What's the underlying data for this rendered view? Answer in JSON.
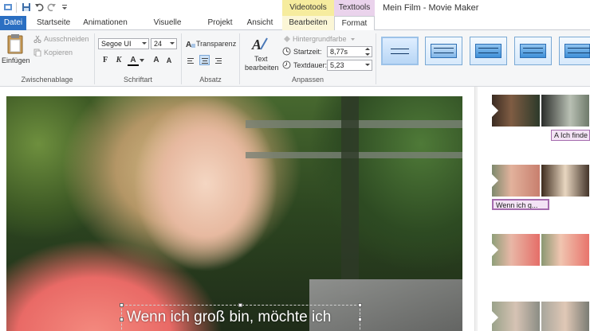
{
  "titlebar": {
    "context_videotools": "Videotools",
    "context_texttools": "Texttools",
    "window_title": "Mein Film - Movie Maker"
  },
  "tabs": {
    "datei": "Datei",
    "startseite": "Startseite",
    "animationen": "Animationen",
    "visuelle_effekte": "Visuelle Effekte",
    "projekt": "Projekt",
    "ansicht": "Ansicht",
    "bearbeiten": "Bearbeiten",
    "format": "Format"
  },
  "ribbon": {
    "clipboard": {
      "paste": "Einfügen",
      "cut": "Ausschneiden",
      "copy": "Kopieren",
      "group": "Zwischenablage"
    },
    "font": {
      "family": "Segoe UI",
      "size": "24",
      "bold": "F",
      "italic": "K",
      "color": "A",
      "grow": "A",
      "shrink": "A",
      "group": "Schriftart"
    },
    "paragraph": {
      "transparency": "Transparenz",
      "group": "Absatz"
    },
    "adjust": {
      "edit_text_line1": "Text",
      "edit_text_line2": "bearbeiten",
      "background_color": "Hintergrundfarbe",
      "start_time_label": "Startzeit:",
      "start_time_value": "8,77s",
      "duration_label": "Textdauer:",
      "duration_value": "5,23",
      "group": "Anpassen"
    }
  },
  "preview": {
    "caption": "Wenn ich groß bin, möchte ich"
  },
  "storyboard": {
    "text_clip_1": "A Ich finde",
    "text_clip_2": "Wenn ich g..."
  },
  "colors": {
    "file_tab": "#2b6fc2",
    "videotools": "#f6ec9e",
    "texttools": "#ead3ec",
    "text_clip": "#f3e3f5"
  }
}
